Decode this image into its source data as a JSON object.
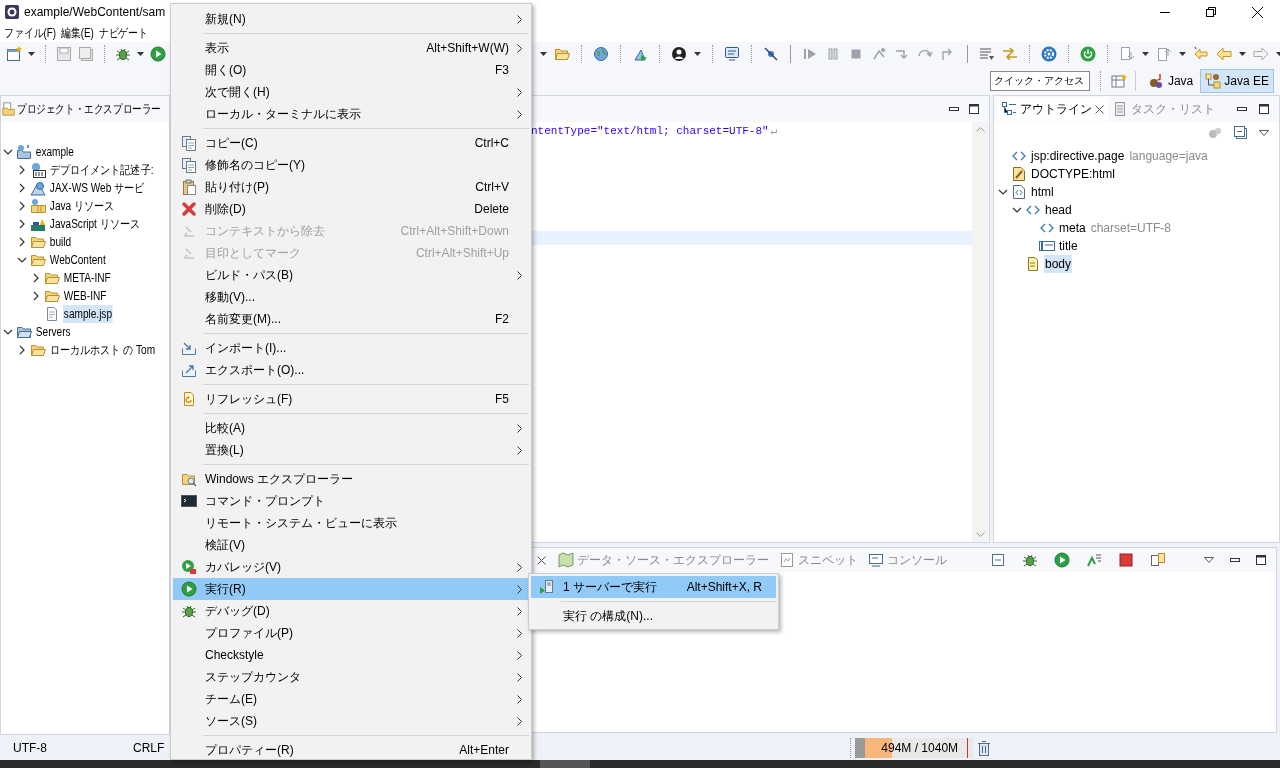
{
  "window": {
    "title": "example/WebContent/sam"
  },
  "menu_bar": [
    "ファイル(F)",
    "編集(E)",
    "ナビゲート"
  ],
  "quick_access": {
    "placeholder": "クイック・アクセス"
  },
  "perspectives": [
    {
      "label": "Java",
      "selected": false
    },
    {
      "label": "Java EE",
      "selected": true
    }
  ],
  "project_explorer": {
    "title": "プロジェクト・エクスプローラー",
    "tree": [
      {
        "label": "example",
        "kind": "project",
        "expanded": true,
        "selected": false,
        "children": [
          {
            "label": "デプロイメント記述子:",
            "kind": "descriptor",
            "expanded": false,
            "selected": false
          },
          {
            "label": "JAX-WS Web サービ",
            "kind": "webservice",
            "expanded": false,
            "selected": false
          },
          {
            "label": "Java リソース",
            "kind": "java-resources",
            "expanded": false,
            "selected": false
          },
          {
            "label": "JavaScript リソース",
            "kind": "js-resources",
            "expanded": false,
            "selected": false
          },
          {
            "label": "build",
            "kind": "folder",
            "expanded": false,
            "selected": false
          },
          {
            "label": "WebContent",
            "kind": "folder",
            "expanded": true,
            "selected": false,
            "children": [
              {
                "label": "META-INF",
                "kind": "folder",
                "expanded": false,
                "selected": false
              },
              {
                "label": "WEB-INF",
                "kind": "folder",
                "expanded": false,
                "selected": false
              },
              {
                "label": "sample.jsp",
                "kind": "file",
                "selected": true
              }
            ]
          }
        ]
      },
      {
        "label": "Servers",
        "kind": "servers",
        "expanded": true,
        "selected": false,
        "children": [
          {
            "label": "ローカルホスト の Tom",
            "kind": "folder",
            "expanded": false,
            "selected": false
          }
        ]
      }
    ]
  },
  "editor": {
    "lines": [
      {
        "text": "ntentType=\"text/html; charset=UTF-8\"",
        "end_mark": "↵"
      }
    ]
  },
  "outline": {
    "tabs": [
      {
        "label": "アウトライン",
        "selected": true
      },
      {
        "label": "タスク・リスト",
        "selected": false
      }
    ],
    "tree": [
      {
        "label": "jsp:directive.page",
        "detail": "language=java",
        "kind": "tag",
        "selected": false
      },
      {
        "label": "DOCTYPE:html",
        "kind": "doctype",
        "selected": false
      },
      {
        "label": "html",
        "kind": "html",
        "expanded": true,
        "selected": false,
        "children": [
          {
            "label": "head",
            "kind": "tag",
            "expanded": true,
            "selected": false,
            "children": [
              {
                "label": "meta",
                "detail": "charset=UTF-8",
                "kind": "tag",
                "selected": false
              },
              {
                "label": "title",
                "kind": "title",
                "selected": false
              }
            ]
          },
          {
            "label": "body",
            "kind": "body",
            "selected": true
          }
        ]
      }
    ]
  },
  "bottom_panel": {
    "tabs": [
      "データ・ソース・エクスプローラー",
      "スニペット",
      "コンソール"
    ]
  },
  "context_menu": {
    "items": [
      {
        "kind": "item",
        "label": "新規(N)",
        "submenu": true,
        "disabled": false,
        "selected": false
      },
      {
        "kind": "separator"
      },
      {
        "kind": "item",
        "label": "表示",
        "shortcut": "Alt+Shift+W(W)",
        "submenu": true,
        "disabled": false,
        "selected": false
      },
      {
        "kind": "item",
        "label": "開く(O)",
        "shortcut": "F3",
        "submenu": false,
        "disabled": false,
        "selected": false
      },
      {
        "kind": "item",
        "label": "次で開く(H)",
        "submenu": true,
        "disabled": false,
        "selected": false
      },
      {
        "kind": "item",
        "label": "ローカル・ターミナルに表示",
        "submenu": true,
        "disabled": false,
        "selected": false
      },
      {
        "kind": "separator"
      },
      {
        "kind": "item",
        "label": "コピー(C)",
        "shortcut": "Ctrl+C",
        "submenu": false,
        "disabled": false,
        "selected": false
      },
      {
        "kind": "item",
        "label": "修飾名のコピー(Y)",
        "submenu": false,
        "disabled": false,
        "selected": false
      },
      {
        "kind": "item",
        "label": "貼り付け(P)",
        "shortcut": "Ctrl+V",
        "submenu": false,
        "disabled": false,
        "selected": false
      },
      {
        "kind": "item",
        "label": "削除(D)",
        "shortcut": "Delete",
        "submenu": false,
        "disabled": false,
        "selected": false
      },
      {
        "kind": "item",
        "label": "コンテキストから除去",
        "shortcut": "Ctrl+Alt+Shift+Down",
        "submenu": false,
        "disabled": true,
        "selected": false
      },
      {
        "kind": "item",
        "label": "目印としてマーク",
        "shortcut": "Ctrl+Alt+Shift+Up",
        "submenu": false,
        "disabled": true,
        "selected": false
      },
      {
        "kind": "item",
        "label": "ビルド・パス(B)",
        "submenu": true,
        "disabled": false,
        "selected": false
      },
      {
        "kind": "item",
        "label": "移動(V)...",
        "submenu": false,
        "disabled": false,
        "selected": false
      },
      {
        "kind": "item",
        "label": "名前変更(M)...",
        "shortcut": "F2",
        "submenu": false,
        "disabled": false,
        "selected": false
      },
      {
        "kind": "separator"
      },
      {
        "kind": "item",
        "label": "インポート(I)...",
        "submenu": false,
        "disabled": false,
        "selected": false
      },
      {
        "kind": "item",
        "label": "エクスポート(O)...",
        "submenu": false,
        "disabled": false,
        "selected": false
      },
      {
        "kind": "separator"
      },
      {
        "kind": "item",
        "label": "リフレッシュ(F)",
        "shortcut": "F5",
        "submenu": false,
        "disabled": false,
        "selected": false
      },
      {
        "kind": "separator"
      },
      {
        "kind": "item",
        "label": "比較(A)",
        "submenu": true,
        "disabled": false,
        "selected": false
      },
      {
        "kind": "item",
        "label": "置換(L)",
        "submenu": true,
        "disabled": false,
        "selected": false
      },
      {
        "kind": "separator"
      },
      {
        "kind": "item",
        "label": "Windows エクスプローラー",
        "submenu": false,
        "disabled": false,
        "selected": false
      },
      {
        "kind": "item",
        "label": "コマンド・プロンプト",
        "submenu": false,
        "disabled": false,
        "selected": false
      },
      {
        "kind": "item",
        "label": "リモート・システム・ビューに表示",
        "submenu": false,
        "disabled": false,
        "selected": false
      },
      {
        "kind": "item",
        "label": "検証(V)",
        "submenu": false,
        "disabled": false,
        "selected": false
      },
      {
        "kind": "item",
        "label": "カバレッジ(V)",
        "submenu": true,
        "disabled": false,
        "selected": false
      },
      {
        "kind": "item",
        "label": "実行(R)",
        "submenu": true,
        "disabled": false,
        "selected": true
      },
      {
        "kind": "item",
        "label": "デバッグ(D)",
        "submenu": true,
        "disabled": false,
        "selected": false
      },
      {
        "kind": "item",
        "label": "プロファイル(P)",
        "submenu": true,
        "disabled": false,
        "selected": false
      },
      {
        "kind": "item",
        "label": "Checkstyle",
        "submenu": true,
        "disabled": false,
        "selected": false
      },
      {
        "kind": "item",
        "label": "ステップカウンタ",
        "submenu": true,
        "disabled": false,
        "selected": false
      },
      {
        "kind": "item",
        "label": "チーム(E)",
        "submenu": true,
        "disabled": false,
        "selected": false
      },
      {
        "kind": "item",
        "label": "ソース(S)",
        "submenu": true,
        "disabled": false,
        "selected": false
      },
      {
        "kind": "separator"
      },
      {
        "kind": "item",
        "label": "プロパティー(R)",
        "shortcut": "Alt+Enter",
        "submenu": false,
        "disabled": false,
        "selected": false
      }
    ]
  },
  "submenu": {
    "items": [
      {
        "kind": "item",
        "label": "1 サーバーで実行",
        "shortcut": "Alt+Shift+X, R",
        "selected": true
      },
      {
        "kind": "separator"
      },
      {
        "kind": "item",
        "label": "実行 の構成(N)...",
        "selected": false
      }
    ]
  },
  "status_bar": {
    "encoding": "UTF-8",
    "line_delimiter": "CRLF",
    "heap": {
      "reading": "494M / 1040M",
      "level": 0.25
    }
  }
}
